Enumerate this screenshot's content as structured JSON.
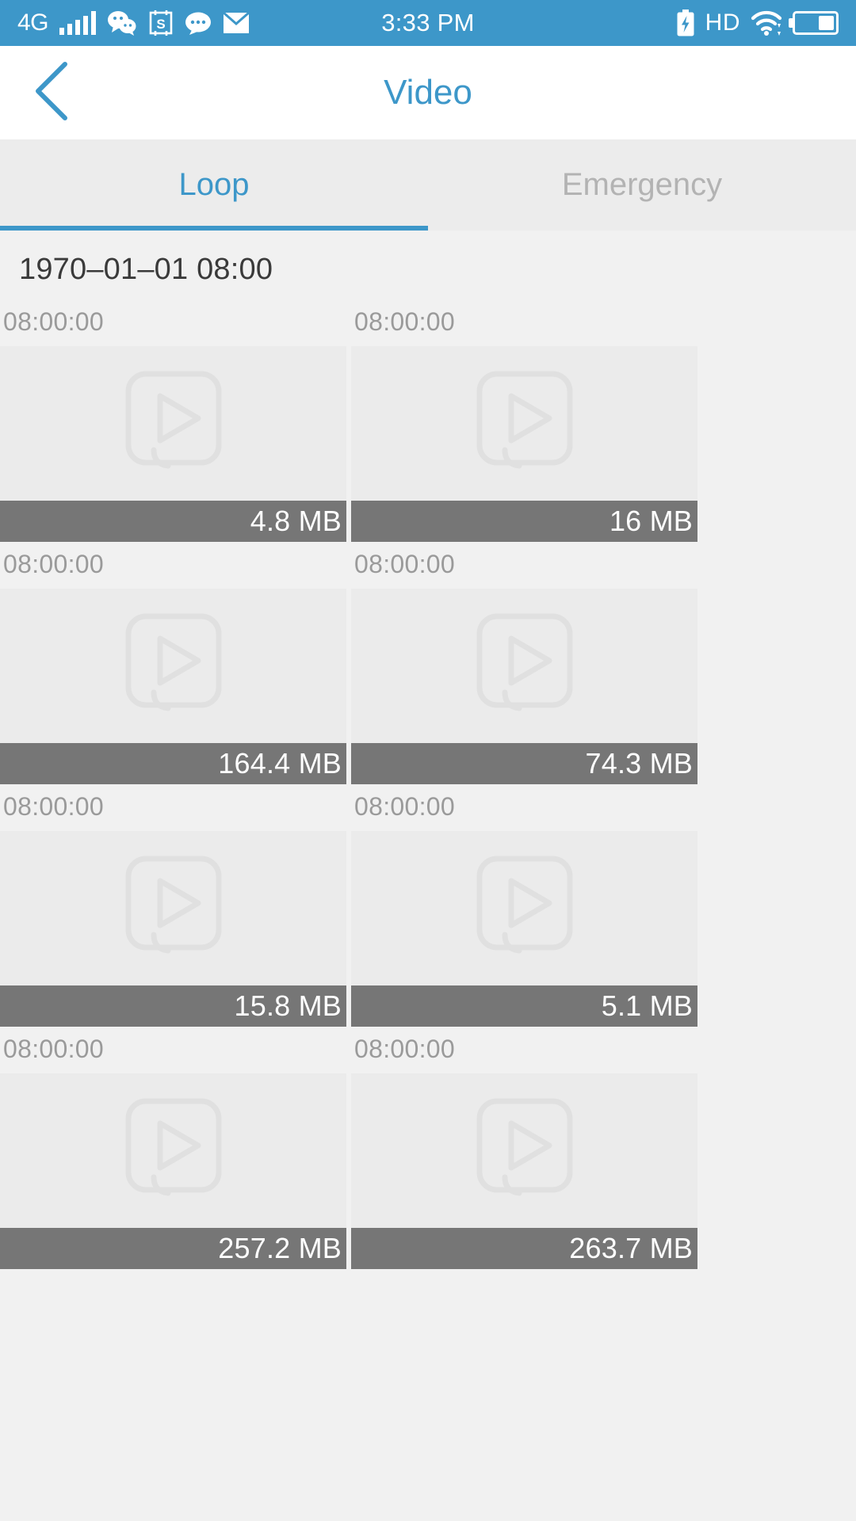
{
  "status_bar": {
    "network": "4G",
    "time": "3:33 PM",
    "hd_label": "HD",
    "icons": [
      "signal-bars-icon",
      "wechat-icon",
      "screenshot-s-icon",
      "message-bubble-icon",
      "email-icon",
      "battery-charging-icon",
      "wifi-icon",
      "battery-level-icon"
    ],
    "background_color": "#3d97c9"
  },
  "nav": {
    "title": "Video",
    "back_icon": "chevron-left-icon",
    "accent_color": "#3d97c9"
  },
  "tabs": [
    {
      "label": "Loop",
      "active": true
    },
    {
      "label": "Emergency",
      "active": false
    }
  ],
  "list": {
    "date_header": "1970–01–01 08:00",
    "rows": [
      {
        "cells": [
          {
            "time": "08:00:00",
            "size": "4.8 MB",
            "icon": "video-play-placeholder-icon"
          },
          {
            "time": "08:00:00",
            "size": "16 MB",
            "icon": "video-play-placeholder-icon"
          }
        ]
      },
      {
        "cells": [
          {
            "time": "08:00:00",
            "size": "164.4 MB",
            "icon": "video-play-placeholder-icon"
          },
          {
            "time": "08:00:00",
            "size": "74.3 MB",
            "icon": "video-play-placeholder-icon"
          }
        ]
      },
      {
        "cells": [
          {
            "time": "08:00:00",
            "size": "15.8 MB",
            "icon": "video-play-placeholder-icon"
          },
          {
            "time": "08:00:00",
            "size": "5.1 MB",
            "icon": "video-play-placeholder-icon"
          }
        ]
      },
      {
        "cells": [
          {
            "time": "08:00:00",
            "size": "257.2 MB",
            "icon": "video-play-placeholder-icon"
          },
          {
            "time": "08:00:00",
            "size": "263.7 MB",
            "icon": "video-play-placeholder-icon"
          }
        ]
      }
    ]
  },
  "colors": {
    "accent": "#3d97c9",
    "page_bg": "#f1f1f1",
    "tab_bg": "#ececec",
    "thumb_bg": "#ebebeb",
    "size_bar_bg": "#767676",
    "muted_text": "#9a9a9a"
  }
}
